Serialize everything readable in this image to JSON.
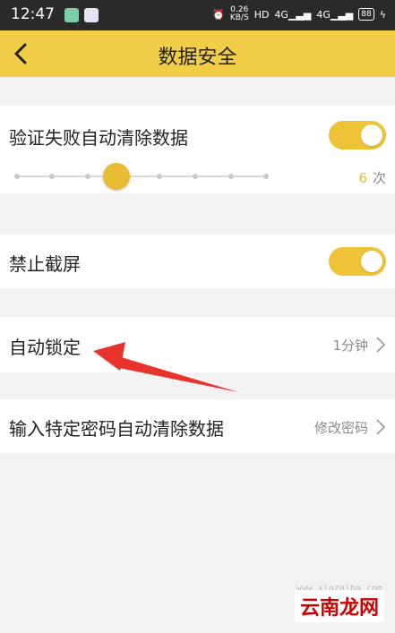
{
  "status_bar": {
    "time": "12:47",
    "net_speed_value": "0.26",
    "net_speed_unit": "KB/S",
    "hd_label": "HD",
    "network_1": "4G",
    "network_2": "4G",
    "battery": "88"
  },
  "header": {
    "title": "数据安全",
    "back_icon": "chevron-left-icon",
    "background_color": "#f2cd47"
  },
  "settings": {
    "auto_clear": {
      "label": "验证失败自动清除数据",
      "enabled": true,
      "attempts": "6",
      "attempts_unit": "次",
      "slider_fraction": 0.4
    },
    "block_screenshot": {
      "label": "禁止截屏",
      "enabled": true
    },
    "auto_lock": {
      "label": "自动锁定",
      "value": "1分钟"
    },
    "duress_password": {
      "label": "输入特定密码自动清除数据",
      "value": "修改密码"
    }
  },
  "watermark": {
    "text": "云南龙网",
    "url": "www.xiazaiba.com"
  },
  "colors": {
    "accent": "#eec337",
    "annotation_arrow": "#e8322c"
  }
}
